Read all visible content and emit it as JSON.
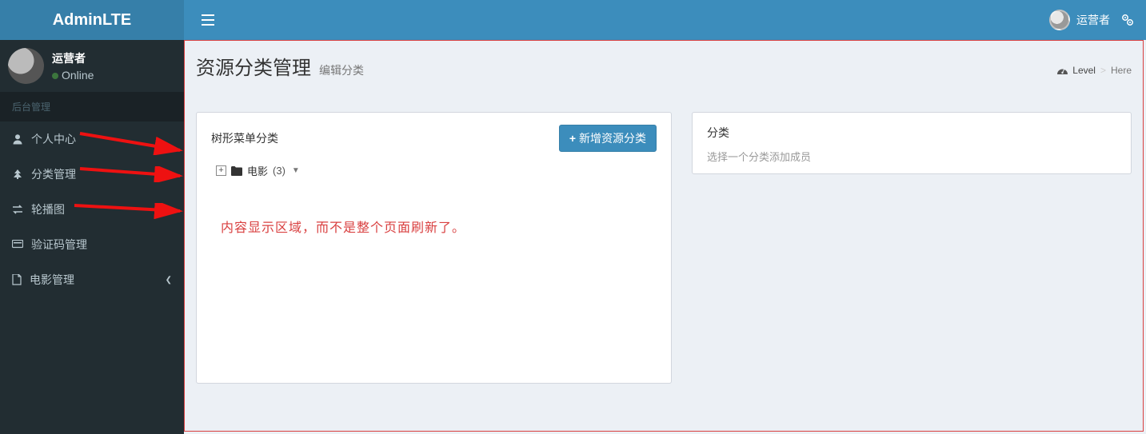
{
  "logo": "AdminLTE",
  "header": {
    "username": "运营者"
  },
  "sidebar": {
    "user": {
      "name": "运营者",
      "status": "Online"
    },
    "section_header": "后台管理",
    "items": [
      {
        "label": "个人中心"
      },
      {
        "label": "分类管理"
      },
      {
        "label": "轮播图"
      },
      {
        "label": "验证码管理"
      },
      {
        "label": "电影管理",
        "has_children": true
      }
    ]
  },
  "page": {
    "title": "资源分类管理",
    "subtitle": "编辑分类",
    "breadcrumb": {
      "level": "Level",
      "here": "Here"
    }
  },
  "left_box": {
    "title": "树形菜单分类",
    "add_button": "新增资源分类",
    "tree": {
      "root_label": "电影",
      "count": "(3)"
    },
    "annotation": "内容显示区域，而不是整个页面刷新了。"
  },
  "right_box": {
    "title": "分类",
    "hint": "选择一个分类添加成员"
  }
}
